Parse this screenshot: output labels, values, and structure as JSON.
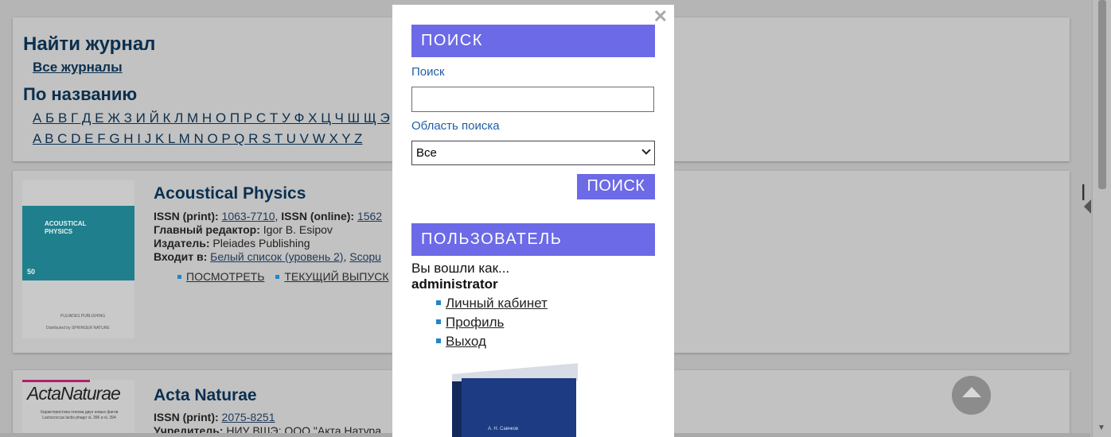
{
  "find_panel": {
    "title": "Найти журнал",
    "all_link": "Все журналы",
    "by_name_title": "По названию",
    "letters_ru": "А Б В Г Д Е Ж З И Й К Л М Н О П Р С Т У Ф Х Ц Ч Ш Щ Э",
    "letters_en": "A B C D E F G H I J K L M N O P Q R S T U V W X Y Z"
  },
  "journals": [
    {
      "title": "Acoustical Physics",
      "cover_title": "ACOUSTICAL\nPHYSICS",
      "cover_volume": "50",
      "cover_publisher": "PLEIADES PUBLISHING",
      "cover_distributed": "Distributed by SPRINGER NATURE",
      "issn_print_label": "ISSN (print):",
      "issn_print": "1063-7710",
      "issn_online_label": "ISSN (online):",
      "issn_online": "1562",
      "editor_label": "Главный редактор:",
      "editor": "Igor B. Esipov",
      "publisher_label": "Издатель:",
      "publisher": "Pleiades Publishing",
      "included_label": "Входит в:",
      "included_1": "Белый список (уровень 2)",
      "included_2": "Scopu",
      "action_view": "ПОСМОТРЕТЬ",
      "action_current": "ТЕКУЩИЙ ВЫПУСК"
    },
    {
      "title": "Acta Naturae",
      "cover_logo": "ActaNaturae",
      "cover_sub": "Характеристика генома двух новых фагов Lactococcus lactis phago vL 396 и vL 394",
      "issn_print_label": "ISSN (print):",
      "issn_print": "2075-8251",
      "founder_label": "Учредитель:",
      "founder": "НИУ ВШЭ; ООО \"Акта Натура"
    }
  ],
  "modal": {
    "close_icon": "close-icon",
    "search_header": "ПОИСК",
    "search_label": "Поиск",
    "search_value": "",
    "area_label": "Область поиска",
    "area_selected": "Все",
    "search_button": "ПОИСК",
    "user_header": "ПОЛЬЗОВАТЕЛЬ",
    "logged_in_as": "Вы вошли как...",
    "username": "administrator",
    "links": [
      "Личный кабинет",
      "Профиль",
      "Выход"
    ],
    "book_author": "А. Н. Савчков"
  },
  "colors": {
    "accent": "#6c6ae6",
    "title": "#0b2f4e",
    "link_blue": "#1f5fa8"
  }
}
